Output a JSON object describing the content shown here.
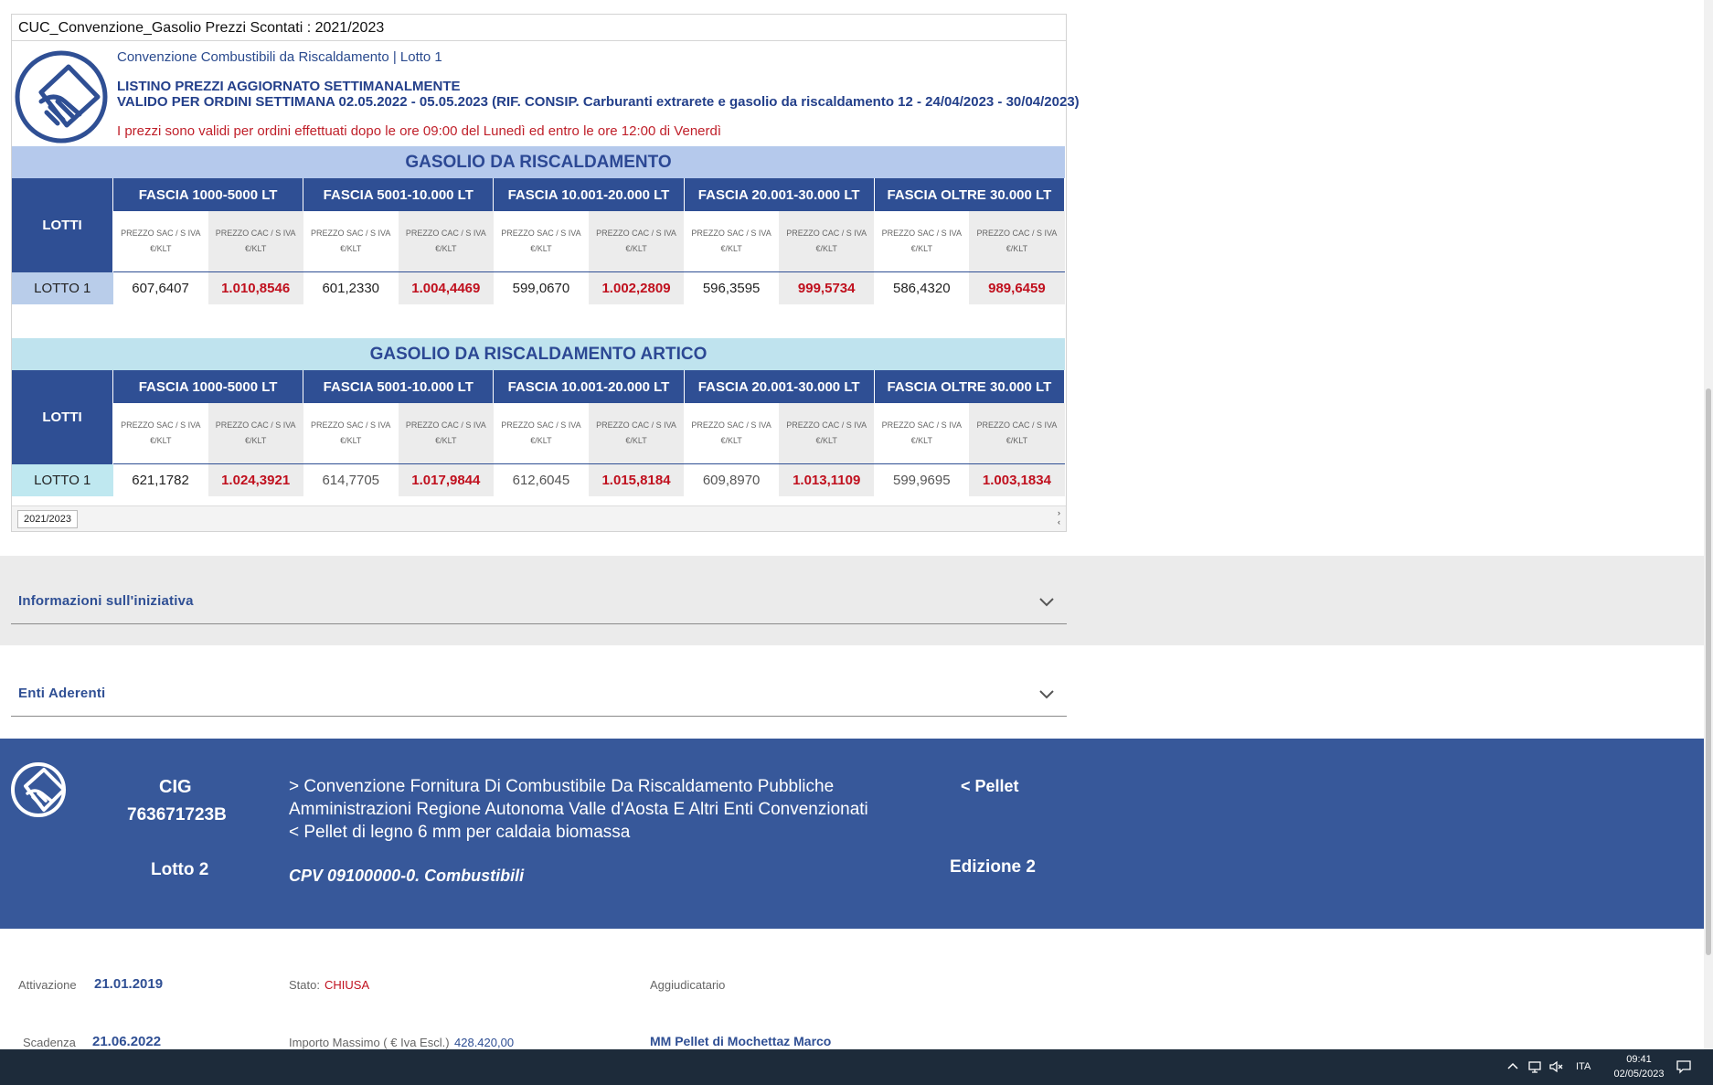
{
  "sheet": {
    "title": "CUC_Convenzione_Gasolio Prezzi Scontati : 2021/2023",
    "subtitle": "Convenzione Combustibili da Riscaldamento | Lotto 1",
    "line1": "LISTINO PREZZI AGGIORNATO SETTIMANALMENTE",
    "line2": "VALIDO PER ORDINI SETTIMANA 02.05.2022 - 05.05.2023 (RIF. CONSIP. Carburanti extrarete e gasolio da riscaldamento 12 - 24/04/2023 - 30/04/2023)",
    "note": "I prezzi sono validi per ordini effettuati dopo le ore 09:00 del Lunedì ed entro le ore 12:00 di Venerdì",
    "lotti_header": "LOTTI",
    "sub_sac_1": "PREZZO SAC / S IVA",
    "sub_sac_2": "€/KLT",
    "sub_cac_1": "PREZZO CAC / S IVA",
    "sub_cac_2": "€/KLT",
    "fasce": [
      "FASCIA 1000-5000 LT",
      "FASCIA 5001-10.000 LT",
      "FASCIA 10.001-20.000 LT",
      "FASCIA 20.001-30.000 LT",
      "FASCIA OLTRE 30.000 LT"
    ],
    "tables": [
      {
        "title": "GASOLIO DA RISCALDAMENTO",
        "lot": "LOTTO 1",
        "values": [
          "607,6407",
          "1.010,8546",
          "601,2330",
          "1.004,4469",
          "599,0670",
          "1.002,2809",
          "596,3595",
          "999,5734",
          "586,4320",
          "989,6459"
        ]
      },
      {
        "title": "GASOLIO DA RISCALDAMENTO ARTICO",
        "lot": "LOTTO 1",
        "values": [
          "621,1782",
          "1.024,3921",
          "614,7705",
          "1.017,9844",
          "612,6045",
          "1.015,8184",
          "609,8970",
          "1.013,1109",
          "599,9695",
          "1.003,1834"
        ]
      }
    ],
    "tab_label": "2021/2023"
  },
  "accordions": [
    {
      "label": "Informazioni sull'iniziativa"
    },
    {
      "label": "Enti Aderenti"
    }
  ],
  "banner": {
    "cig_label": "CIG",
    "cig_value": "763671723B",
    "lot_label": "Lotto 2",
    "desc_line1": "> Convenzione Fornitura Di Combustibile Da Riscaldamento Pubbliche",
    "desc_line2": "Amministrazioni Regione Autonoma Valle d'Aosta E Altri Enti Convenzionati",
    "desc_line3": "< Pellet di legno 6 mm per caldaia biomassa",
    "cpv": "CPV  09100000-0. Combustibili",
    "category": "< Pellet",
    "edition": "Edizione 2"
  },
  "details": {
    "attivazione_label": "Attivazione",
    "attivazione_value": "21.01.2019",
    "stato_label": "Stato:",
    "stato_value": "CHIUSA",
    "aggiudicatario_label": "Aggiudicatario",
    "scadenza_label": "Scadenza",
    "scadenza_value": "21.06.2022",
    "importo_label": "Importo Massimo ( € Iva Escl.)",
    "importo_value": "428.420,00",
    "aggiudicatario_value": "MM Pellet di Mochettaz Marco"
  },
  "taskbar": {
    "lang": "ITA",
    "time": "09:41",
    "date": "02/05/2023",
    "icons": [
      "chevron-up-icon",
      "network-icon",
      "volume-muted-icon",
      "notification-icon"
    ]
  },
  "colors": {
    "primary": "#2f4f94",
    "banner": "#37589a",
    "accent_red": "#c0101e",
    "band_1": "#b5c9ec",
    "band_2": "#bfe3ee"
  }
}
